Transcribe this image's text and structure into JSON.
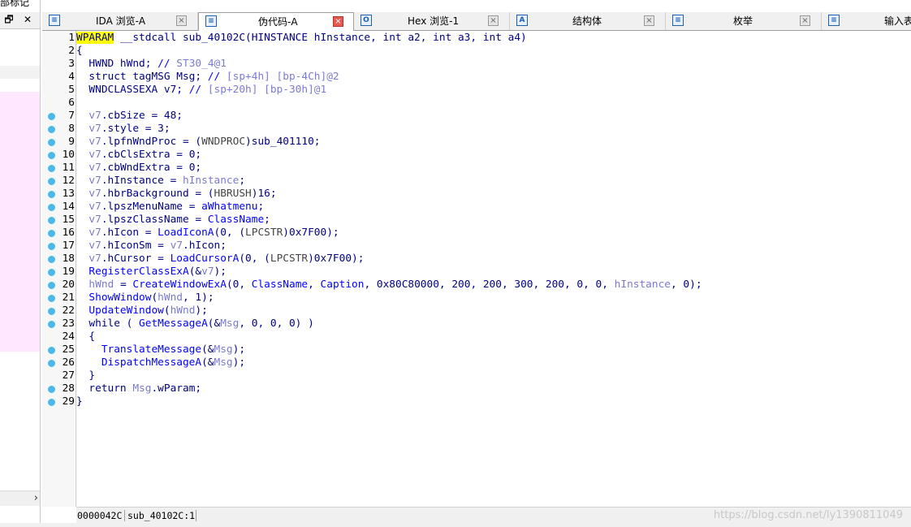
{
  "left_panel": {
    "title": "部标记",
    "float_button": "🗗",
    "close_button": "✕",
    "scroll_right": "›"
  },
  "tabs": [
    {
      "label": "IDA 浏览-A",
      "icon": "ida-view-icon",
      "glyph": "≡",
      "active": false,
      "close": "×"
    },
    {
      "label": "伪代码-A",
      "icon": "pseudocode-icon",
      "glyph": "≡",
      "active": true,
      "close": "×"
    },
    {
      "label": "Hex 浏览-1",
      "icon": "hex-view-icon",
      "glyph": "O",
      "active": false,
      "close": "×"
    },
    {
      "label": "结构体",
      "icon": "structures-icon",
      "glyph": "A",
      "active": false,
      "close": "×"
    },
    {
      "label": "枚举",
      "icon": "enums-icon",
      "glyph": "≡",
      "active": false,
      "close": "×"
    },
    {
      "label": "输入表",
      "icon": "imports-icon",
      "glyph": "≡",
      "active": false,
      "close": ""
    }
  ],
  "code": {
    "line_numbers": [
      "1",
      "2",
      "3",
      "4",
      "5",
      "6",
      "7",
      "8",
      "9",
      "10",
      "11",
      "12",
      "13",
      "14",
      "15",
      "16",
      "17",
      "18",
      "19",
      "20",
      "21",
      "22",
      "23",
      "24",
      "25",
      "26",
      "27",
      "28",
      "29"
    ],
    "breakpoint_lines": [
      7,
      8,
      9,
      10,
      11,
      12,
      13,
      14,
      15,
      16,
      17,
      18,
      19,
      20,
      21,
      22,
      23,
      25,
      26,
      28,
      29
    ],
    "line1": {
      "ret_type": "WPARAM",
      "signature": " __stdcall sub_40102C(HINSTANCE hInstance, int a2, int a3, int a4)"
    },
    "line2": "{",
    "line3": {
      "decl": "  HWND hWnd; ",
      "comment": "// ",
      "loc": "ST30_4@1"
    },
    "line4": {
      "decl": "  struct tagMSG Msg; ",
      "comment": "// ",
      "loc": "[sp+4h] [bp-4Ch]@2"
    },
    "line5": {
      "decl": "  WNDCLASSEXA v7; ",
      "comment": "// ",
      "loc": "[sp+20h] [bp-30h]@1"
    },
    "line6": "",
    "line7": {
      "v": "  v7",
      "rest": ".cbSize = 48;"
    },
    "line8": {
      "v": "  v7",
      "rest": ".style = 3;"
    },
    "line9": {
      "v": "  v7",
      "mid": ".lpfnWndProc = (",
      "cast": "WNDPROC",
      "end": ")sub_401110;"
    },
    "line10": {
      "v": "  v7",
      "rest": ".cbClsExtra = 0;"
    },
    "line11": {
      "v": "  v7",
      "rest": ".cbWndExtra = 0;"
    },
    "line12": {
      "v": "  v7",
      "mid": ".hInstance = ",
      "arg": "hInstance",
      "end": ";"
    },
    "line13": {
      "v": "  v7",
      "mid": ".hbrBackground = (",
      "cast": "HBRUSH",
      "end": ")16;"
    },
    "line14": {
      "v": "  v7",
      "mid": ".lpszMenuName = ",
      "fn": "aWhatmenu",
      "end": ";"
    },
    "line15": {
      "v": "  v7",
      "mid": ".lpszClassName = ",
      "fn": "ClassName",
      "end": ";"
    },
    "line16": {
      "v": "  v7",
      "mid": ".hIcon = ",
      "fn": "LoadIconA",
      "p1": "(0, (",
      "cast": "LPCSTR",
      "end": ")0x7F00);"
    },
    "line17": {
      "v": "  v7",
      "mid": ".hIconSm = ",
      "v2": "v7",
      "end": ".hIcon;"
    },
    "line18": {
      "v": "  v7",
      "mid": ".hCursor = ",
      "fn": "LoadCursorA",
      "p1": "(0, (",
      "cast": "LPCSTR",
      "end": ")0x7F00);"
    },
    "line19": {
      "fn": "  RegisterClassExA",
      "p1": "(&",
      "v": "v7",
      "end": ");"
    },
    "line20": {
      "v": "  hWnd",
      "mid": " = ",
      "fn": "CreateWindowExA",
      "p1": "(0, ",
      "fn2": "ClassName",
      "p2": ", ",
      "fn3": "Caption",
      "p3": ", 0x80C80000, 200, 200, 300, 200, 0, 0, ",
      "arg": "hInstance",
      "end": ", 0);"
    },
    "line21": {
      "fn": "  ShowWindow",
      "p1": "(",
      "v": "hWnd",
      "end": ", 1);"
    },
    "line22": {
      "fn": "  UpdateWindow",
      "p1": "(",
      "v": "hWnd",
      "end": ");"
    },
    "line23": {
      "kw": "  while ( ",
      "fn": "GetMessageA",
      "p1": "(&",
      "v": "Msg",
      "end": ", 0, 0, 0) )"
    },
    "line24": "  {",
    "line25": {
      "fn": "    TranslateMessage",
      "p1": "(&",
      "v": "Msg",
      "end": ");"
    },
    "line26": {
      "fn": "    DispatchMessageA",
      "p1": "(&",
      "v": "Msg",
      "end": ");"
    },
    "line27": "  }",
    "line28": {
      "kw": "  return ",
      "v": "Msg",
      "end": ".wParam;"
    },
    "line29": "}"
  },
  "status": {
    "address": "0000042C",
    "function": "sub_40102C:1",
    "watermark": "https://blog.csdn.net/ly1390811049"
  },
  "colors": {
    "highlight": "#ffff00",
    "breakpoint": "#4cb8e8",
    "keyword": "#000080",
    "function": "#0000ff",
    "variable": "#7a7acc"
  }
}
